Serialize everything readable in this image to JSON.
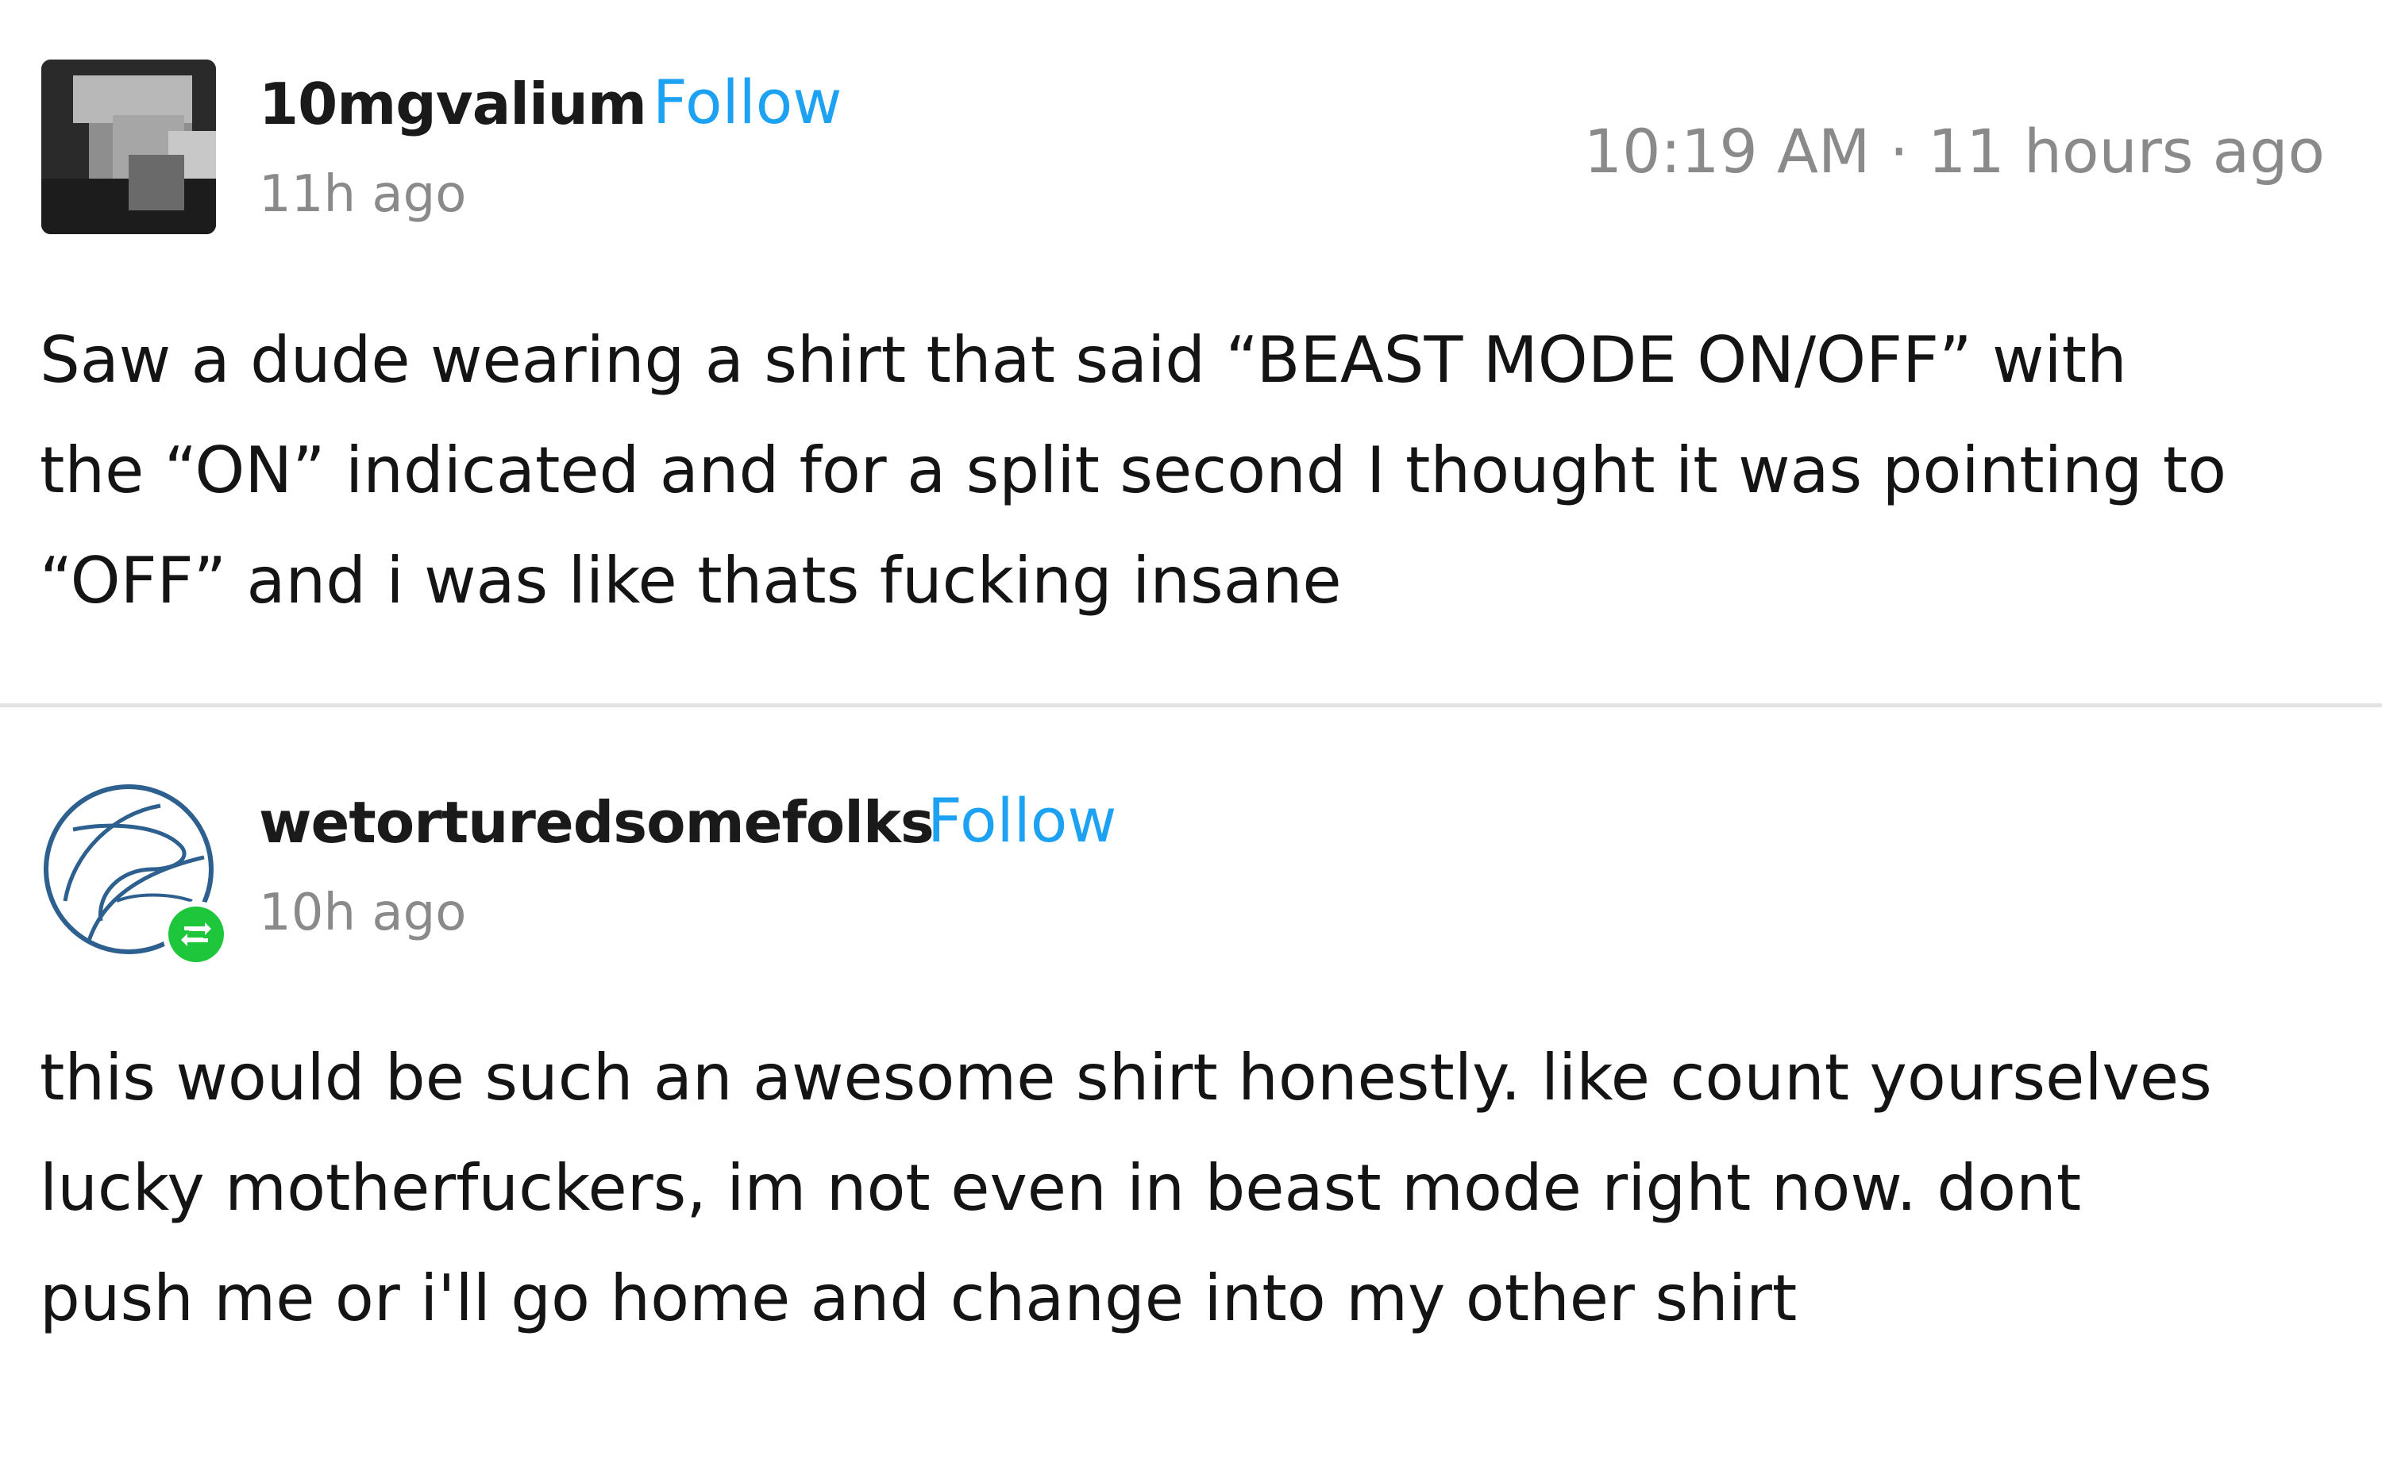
{
  "posts": [
    {
      "username": "10mgvalium",
      "follow_label": "Follow",
      "time_ago": "11h ago",
      "timestamp": "10:19 AM · 11 hours ago",
      "body": "Saw a dude wearing a shirt that said “BEAST MODE ON/OFF” with\nthe “ON” indicated and for a split second I thought it was pointing to\n“OFF” and i was like thats fucking insane"
    },
    {
      "username": "wetorturedsomefolks",
      "follow_label": "Follow",
      "time_ago": "10h ago",
      "body": "this would be such an awesome shirt honestly. like count yourselves\nlucky motherfuckers, im not even in beast mode right now. dont\npush me or i'll go home and change into my other shirt"
    }
  ],
  "colors": {
    "follow": "#1da1f2",
    "muted": "#8a8a8a",
    "text": "#141414",
    "reblog_badge": "#1ec63c",
    "divider": "#e3e3e3"
  },
  "icons": {
    "post_1_avatar": "pixelated-avatar",
    "post_2_avatar": "blue-sphere-avatar-icon",
    "reblog": "reblog-icon"
  }
}
